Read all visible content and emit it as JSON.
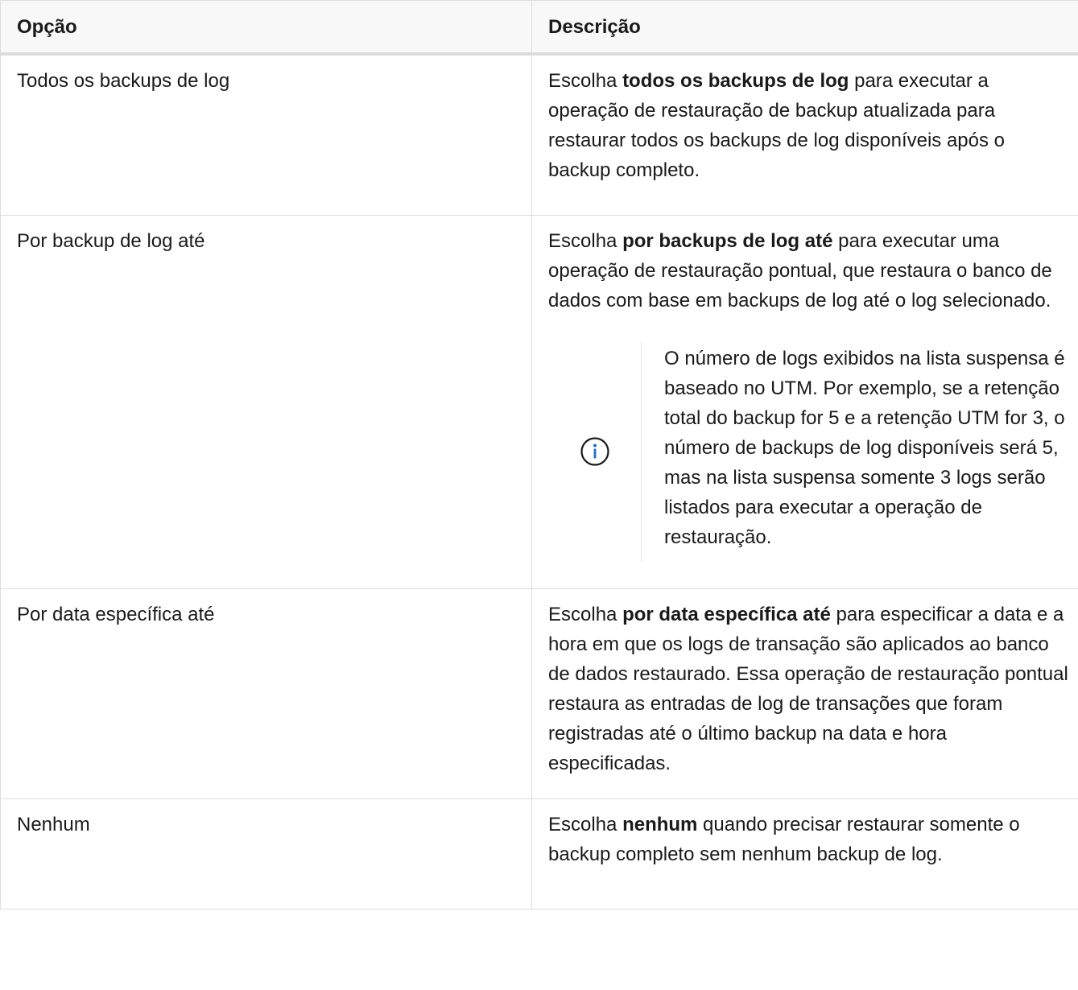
{
  "table": {
    "headers": {
      "option": "Opção",
      "description": "Descrição"
    },
    "rows": [
      {
        "option": "Todos os backups de log",
        "desc_pre": "Escolha ",
        "desc_bold": "todos os backups de log",
        "desc_post": " para executar a operação de restauração de backup atualizada para restaurar todos os backups de log disponíveis após o backup completo."
      },
      {
        "option": "Por backup de log até",
        "desc_pre": "Escolha ",
        "desc_bold": "por backups de log até",
        "desc_post": " para executar uma operação de restauração pontual, que restaura o banco de dados com base em backups de log até o log selecionado.",
        "note": {
          "icon": "info-circle-icon",
          "text": "O número de logs exibidos na lista suspensa é baseado no UTM. Por exemplo, se a retenção total do backup for 5 e a retenção UTM for 3, o número de backups de log disponíveis será 5, mas na lista suspensa somente 3 logs serão listados para executar a operação de restauração."
        }
      },
      {
        "option": "Por data específica até",
        "desc_pre": "Escolha ",
        "desc_bold": "por data específica até",
        "desc_post": " para especificar a data e a hora em que os logs de transação são aplicados ao banco de dados restaurado. Essa operação de restauração pontual restaura as entradas de log de transações que foram registradas até o último backup na data e hora especificadas."
      },
      {
        "option": "Nenhum",
        "desc_pre": "Escolha ",
        "desc_bold": "nenhum",
        "desc_post": " quando precisar restaurar somente o backup completo sem nenhum backup de log."
      }
    ]
  },
  "colors": {
    "info_icon": "#1f6fbf",
    "border": "#dedede",
    "header_bg": "#f8f8f8"
  }
}
